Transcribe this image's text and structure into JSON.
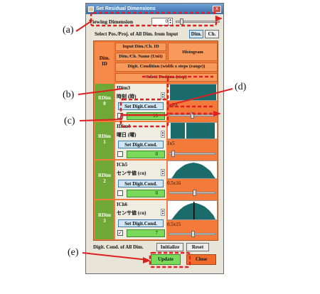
{
  "window": {
    "title": "Set Residual Dimensions",
    "close_glyph": "x"
  },
  "viewing": {
    "label": "Viewing Dimension",
    "value": "0"
  },
  "select_row": {
    "label": "Select Pos./Proj. of All Dim. from Input",
    "dim_button": "Dim.",
    "ch_button": "Ch."
  },
  "header": {
    "dim_id_line1": "Dim.",
    "dim_id_line2": "ID",
    "input_dim": "Input Dim./Ch. ID",
    "name_unit": "Dim./Ch. Name (Unit)",
    "histogram": "Histogram",
    "digit_condition": "Digit. Condition  (width x steps (range))",
    "select_position": "Select Position (step)"
  },
  "rows": [
    {
      "rdim": "RDim",
      "num": "0",
      "id": "IDim3",
      "unit": "時刻 (時)",
      "button": "Set Digit.Cond.",
      "digit": "1x20",
      "checked": false,
      "check_mark": "",
      "value": "10"
    },
    {
      "rdim": "RDim",
      "num": "1",
      "id": "IDim4",
      "unit": "曜日 (曜)",
      "button": "Set Digit.Cond.",
      "digit": "1x5",
      "checked": false,
      "check_mark": "",
      "value": "0"
    },
    {
      "rdim": "RDim",
      "num": "2",
      "id": "ICh5",
      "unit": "センサ値 (cu)",
      "button": "Set Digit.Cond.",
      "digit": "0.5x16",
      "checked": false,
      "check_mark": "",
      "value": "0"
    },
    {
      "rdim": "RDim",
      "num": "3",
      "id": "ICh6",
      "unit": "センサ値 (cu)",
      "button": "Set Digit.Cond.",
      "digit": "0.5x15",
      "checked": true,
      "check_mark": "✓",
      "value": "7"
    }
  ],
  "footer": {
    "label": "Digit. Cond. of All Dim.",
    "initialize": "Initialize",
    "reset": "Reset",
    "update": "Update",
    "close": "Close"
  },
  "callouts": {
    "a": "(a)",
    "b": "(b)",
    "c": "(c)",
    "d": "(d)",
    "e": "(e)"
  },
  "colors": {
    "accent_orange": "#f47a3a",
    "rdim_green": "#6fa836",
    "highlight_red": "#e02020",
    "histogram_teal": "#1c6b6b"
  }
}
